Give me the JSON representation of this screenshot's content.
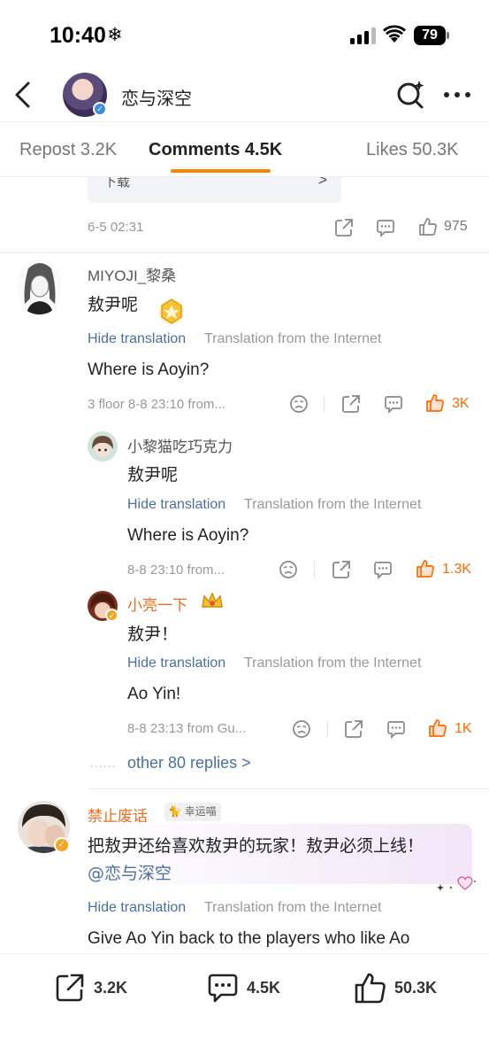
{
  "status_bar": {
    "time": "10:40",
    "snow": "❄",
    "battery": "79"
  },
  "header": {
    "title": "恋与深空"
  },
  "tabs": [
    {
      "label": "Repost 3.2K"
    },
    {
      "label": "Comments 4.5K"
    },
    {
      "label": "Likes 50.3K"
    }
  ],
  "top_card": {
    "label": "下载",
    "arrow": ">"
  },
  "first_meta": {
    "timestamp": "6-5 02:31",
    "likes": "975"
  },
  "comment1": {
    "user": "MIYOJI_黎桑",
    "text": "敖尹呢",
    "hide_translation": "Hide translation",
    "translation_source": "Translation from the Internet",
    "translation": "Where is Aoyin?",
    "meta": "3 floor 8-8 23:10  from...",
    "likes": "3K"
  },
  "reply1": {
    "user": "小黎猫吃巧克力",
    "text": "敖尹呢",
    "hide_translation": "Hide translation",
    "translation_source": "Translation from the Internet",
    "translation": "Where is Aoyin?",
    "meta": "8-8 23:10  from...",
    "likes": "1.3K"
  },
  "reply2": {
    "user": "小亮一下",
    "text": "敖尹！",
    "hide_translation": "Hide translation",
    "translation_source": "Translation from the Internet",
    "translation": "Ao Yin!",
    "meta": "8-8 23:13  from Gu...",
    "likes": "1K"
  },
  "more_replies": {
    "dots": "......",
    "label": "other 80 replies >"
  },
  "comment2": {
    "user": "禁止废话",
    "badge": "幸运喵",
    "text_line1": "把敖尹还给喜欢敖尹的玩家！敖尹必须上线！",
    "mention": "@恋与深空",
    "hide_translation": "Hide translation",
    "translation_source": "Translation from the Internet",
    "translation": "Give Ao Yin back to the players who like Ao"
  },
  "bottom_bar": {
    "repost": "3.2K",
    "comments": "4.5K",
    "likes": "50.3K"
  },
  "colors": {
    "accent": "#ff8200",
    "link": "#4a6fa5",
    "liked": "#ff6a00",
    "verified": "#3a8ee6"
  }
}
